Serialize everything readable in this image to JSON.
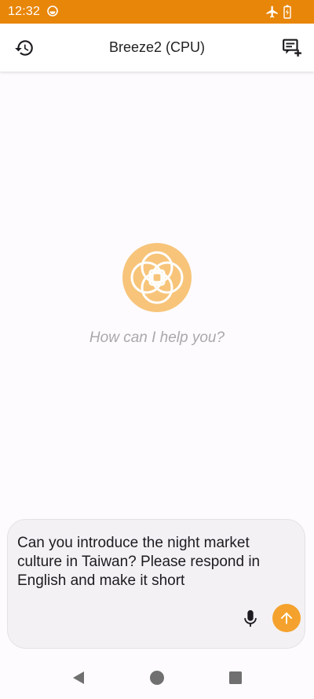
{
  "status_bar": {
    "time": "12:32",
    "icons": [
      "app-notification-icon",
      "airplane-mode-icon",
      "battery-charging-icon"
    ],
    "background": "#e8860a"
  },
  "app_bar": {
    "title": "Breeze2 (CPU)",
    "left_icon": "history-icon",
    "right_icon": "new-chat-icon"
  },
  "main": {
    "logo_icon": "flower-of-life-logo",
    "greeting": "How can I help you?"
  },
  "composer": {
    "message": "Can you introduce the night market culture in Taiwan? Please respond in English and make it short",
    "mic_icon": "microphone-icon",
    "send_icon": "arrow-up-icon",
    "accent": "#f4a22d"
  },
  "nav_bar": {
    "icons": [
      "back-icon",
      "home-icon",
      "recents-icon"
    ]
  }
}
